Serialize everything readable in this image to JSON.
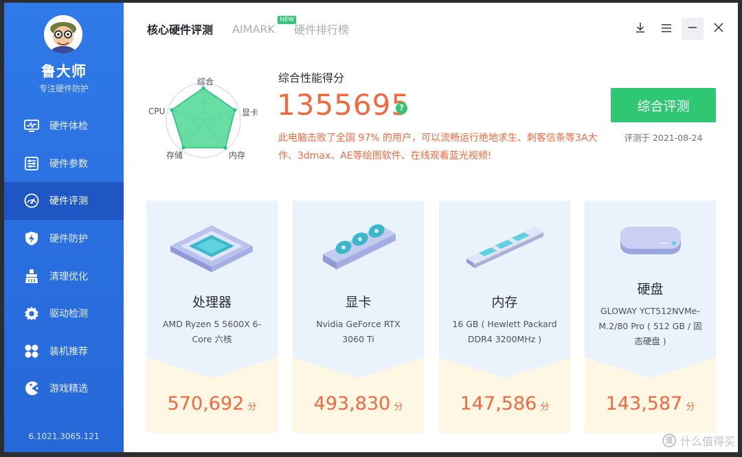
{
  "brand": {
    "name": "鲁大师",
    "slogan": "专注硬件防护",
    "version": "6.1021.3065.121"
  },
  "sidebar": {
    "items": [
      {
        "label": "硬件体检",
        "icon": "monitor-pulse-icon"
      },
      {
        "label": "硬件参数",
        "icon": "sliders-icon"
      },
      {
        "label": "硬件评测",
        "icon": "speedometer-icon",
        "active": true
      },
      {
        "label": "硬件防护",
        "icon": "shield-bolt-icon"
      },
      {
        "label": "清理优化",
        "icon": "broom-icon"
      },
      {
        "label": "驱动检测",
        "icon": "gear-icon"
      },
      {
        "label": "装机推荐",
        "icon": "grid-four-icon"
      },
      {
        "label": "游戏精选",
        "icon": "pacman-icon"
      }
    ]
  },
  "tabs": [
    {
      "label": "核心硬件评测",
      "active": true
    },
    {
      "label": "AIMARK",
      "badge": "NEW"
    },
    {
      "label": "硬件排行榜"
    }
  ],
  "radar": {
    "labels": {
      "top": "综合",
      "right": "显卡",
      "bottom_right": "内存",
      "bottom_left": "存储",
      "left": "CPU"
    }
  },
  "score": {
    "title": "综合性能得分",
    "value": "1355695",
    "description": "此电脑击败了全国 97% 的用户，可以流畅运行绝地求生、刺客信条等3A大作、3dmax、AE等绘图软件、在线观看蓝光视频!",
    "button": "综合评测",
    "date": "评测于 2021-08-24"
  },
  "cards": [
    {
      "name": "处理器",
      "detail": "AMD Ryzen 5 5600X 6-Core 六核",
      "score": "570,692",
      "unit": "分"
    },
    {
      "name": "显卡",
      "detail": "Nvidia GeForce RTX 3060 Ti",
      "score": "493,830",
      "unit": "分"
    },
    {
      "name": "内存",
      "detail": "16 GB ( Hewlett Packard DDR4 3200MHz )",
      "score": "147,586",
      "unit": "分"
    },
    {
      "name": "硬盘",
      "detail": "GLOWAY YCT512NVMe-M.2/80 Pro ( 512 GB / 固态硬盘 )",
      "score": "143,587",
      "unit": "分"
    }
  ],
  "watermark": {
    "logo": "值",
    "text": "什么值得买"
  },
  "colors": {
    "sidebar": "#2a6fe0",
    "accent_green": "#2fc774",
    "score_orange": "#f4683f",
    "card_blue": "#eaf2fc",
    "card_cream": "#fdf7e3"
  }
}
